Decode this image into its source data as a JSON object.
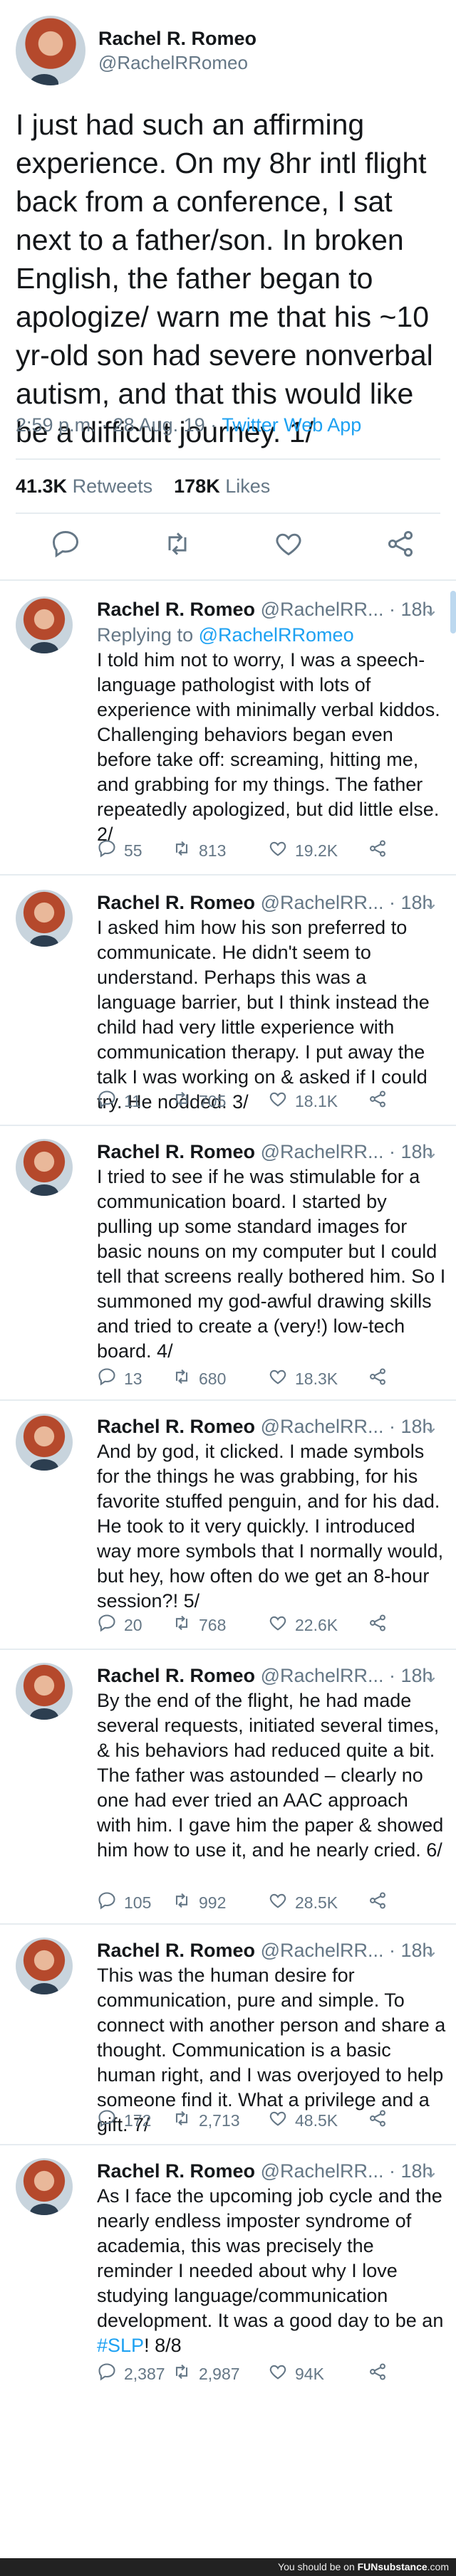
{
  "main_tweet": {
    "name": "Rachel R. Romeo",
    "handle": "@RachelRRomeo",
    "text": "I just had such an affirming experience. On my 8hr intl flight back from a conference, I sat next to a father/son. In broken English, the father began to apologize/ warn me that his ~10 yr-old son had severe nonverbal autism, and that this would like be a difficult journey. 1/",
    "time": "2:59 p.m. · 28 Aug. 19 · ",
    "app": "Twitter Web App",
    "retweets_count": "41.3K",
    "retweets_label": " Retweets",
    "likes_count": "178K",
    "likes_label": " Likes"
  },
  "replies": [
    {
      "name": "Rachel R. Romeo",
      "handle": " @RachelRR...",
      "time": " · 18h",
      "replying_prefix": "Replying to ",
      "replying_to": "@RachelRRomeo",
      "text": "I told him not to worry, I was a speech-language pathologist with lots of experience with minimally verbal kiddos. Challenging behaviors began even before take off: screaming, hitting me, and grabbing for my things. The father repeatedly apologized, but did little else. 2/",
      "replies": "55",
      "retweets": "813",
      "likes": "19.2K"
    },
    {
      "name": "Rachel R. Romeo",
      "handle": " @RachelRR...",
      "time": " · 18h",
      "text": "I asked him how his son preferred to communicate. He didn't seem to understand. Perhaps this was a language barrier, but I think instead the child had very little experience with communication therapy. I put away the talk I was working on & asked if I could try. He nodded. 3/",
      "replies": "11",
      "retweets": "705",
      "likes": "18.1K"
    },
    {
      "name": "Rachel R. Romeo",
      "handle": " @RachelRR...",
      "time": " · 18h",
      "text": "I tried to see if he was stimulable for a communication board. I started by pulling up some standard images for basic nouns on my computer but I could tell that screens really bothered him. So I summoned my god-awful drawing skills and tried to create a (very!) low-tech board. 4/",
      "replies": "13",
      "retweets": "680",
      "likes": "18.3K"
    },
    {
      "name": "Rachel R. Romeo",
      "handle": " @RachelRR...",
      "time": " · 18h",
      "text": "And by god, it clicked. I made symbols for the things he was grabbing, for his favorite stuffed penguin, and for his dad. He took to it very quickly. I introduced way more symbols that I normally would, but hey, how often do we get an 8-hour session?! 5/",
      "replies": "20",
      "retweets": "768",
      "likes": "22.6K"
    },
    {
      "name": "Rachel R. Romeo",
      "handle": " @RachelRR...",
      "time": " · 18h",
      "text": "By the end of the flight, he had made several requests, initiated several times, & his behaviors had reduced quite a bit. The father was astounded – clearly no one had ever tried an AAC approach with him. I gave him the paper & showed him how to use it, and he nearly cried. 6/",
      "replies": "105",
      "retweets": "992",
      "likes": "28.5K"
    },
    {
      "name": "Rachel R. Romeo",
      "handle": " @RachelRR...",
      "time": " · 18h",
      "text": "This was the human desire for communication, pure and simple. To connect with another person and share a thought. Communication is a basic human right, and I was overjoyed to help someone find it. What a privilege and a gift. 7/",
      "replies": "172",
      "retweets": "2,713",
      "likes": "48.5K"
    },
    {
      "name": "Rachel R. Romeo",
      "handle": " @RachelRR...",
      "time": " · 18h",
      "text": "As I face the upcoming job cycle and the nearly endless imposter syndrome of academia, this was precisely the reminder I needed about why I love studying language/communication development. It was a good day to be an ",
      "hashtag": "#SLP",
      "text_end": "! 8/8",
      "replies": "2,387",
      "retweets": "2,987",
      "likes": "94K"
    }
  ],
  "footer": {
    "prefix": "You should be on ",
    "site": "FUNsubstance",
    "suffix": ".com"
  },
  "colors": {
    "text": "#14171a",
    "muted": "#657786",
    "link": "#1da1f2",
    "divider": "#e6ecf0"
  },
  "icons": [
    "reply-icon",
    "retweet-icon",
    "like-icon",
    "share-icon",
    "chevron-down-icon"
  ]
}
